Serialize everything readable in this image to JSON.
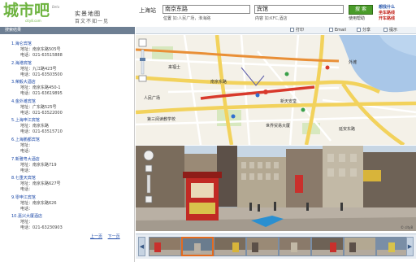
{
  "header": {
    "logo_text": "城市吧",
    "logo_beta": "Beta",
    "logo_domain": "city8.com",
    "slogan_line1": "实景地图",
    "slogan_line2": "百文不如一见",
    "city": "上海站",
    "location_value": "南京东路",
    "location_hint_label": "位置",
    "location_hint": "如:人民广场，淮海路",
    "keyword_value": "宾馆",
    "keyword_hint_label": "内容",
    "keyword_hint": "如:KFC,酒店",
    "search_label": "搜 索",
    "help_label": "使用帮助",
    "promo_line1": "想找什么",
    "promo_line2": "坐车路线",
    "promo_line3": "开车路线"
  },
  "left": {
    "header_title": "搜索结果",
    "address_prefix": "地址：",
    "phone_prefix": "电话：",
    "results": [
      {
        "title": "1.海仑宾馆",
        "address": "南京东路505号",
        "phone": "021-63515888"
      },
      {
        "title": "2.海港宾馆",
        "address": "九江路423号",
        "phone": "021-63503500"
      },
      {
        "title": "3.荣毅大酒店",
        "address": "南京东路450-1",
        "phone": "021-63619895"
      },
      {
        "title": "4.金外滩宾馆",
        "address": "广东路525号",
        "phone": "021-63522000"
      },
      {
        "title": "5.上海申江宾馆",
        "address": "南京东路",
        "phone": "021-63515710"
      },
      {
        "title": "6.上海鹏都宾馆",
        "address": "",
        "phone": ""
      },
      {
        "title": "7.新雅粤大酒店",
        "address": "南京东路719",
        "phone": ""
      },
      {
        "title": "8.七重天宾馆",
        "address": "南京东路627号",
        "phone": ""
      },
      {
        "title": "9.零申江宾馆",
        "address": "南京东路626",
        "phone": ""
      },
      {
        "title": "10.嘉兴大厦酒店",
        "address": "",
        "phone": "021-63230903"
      }
    ],
    "prev_page": "上一页",
    "next_page": "下一页"
  },
  "toolbar": {
    "print": "打印",
    "email": "Email",
    "share": "分享",
    "help": "提示"
  },
  "map": {
    "labels": {
      "l1": "南京东路",
      "l2": "外滩",
      "l3": "人民广场",
      "l4": "来福士",
      "l5": "新天安堂",
      "l6": "世界贸易大厦",
      "l7": "第三阅读教学校",
      "l8": "延安东路"
    }
  },
  "street": {
    "watermark": "© city8"
  },
  "colors": {
    "brand_green": "#6db33f",
    "link_blue": "#1c49a8",
    "panel_head": "#6e7f93",
    "promo_red": "#c3241c",
    "road_yellow": "#f2d25c",
    "water_blue": "#a9c7e8",
    "route_red": "#d83a2c"
  }
}
